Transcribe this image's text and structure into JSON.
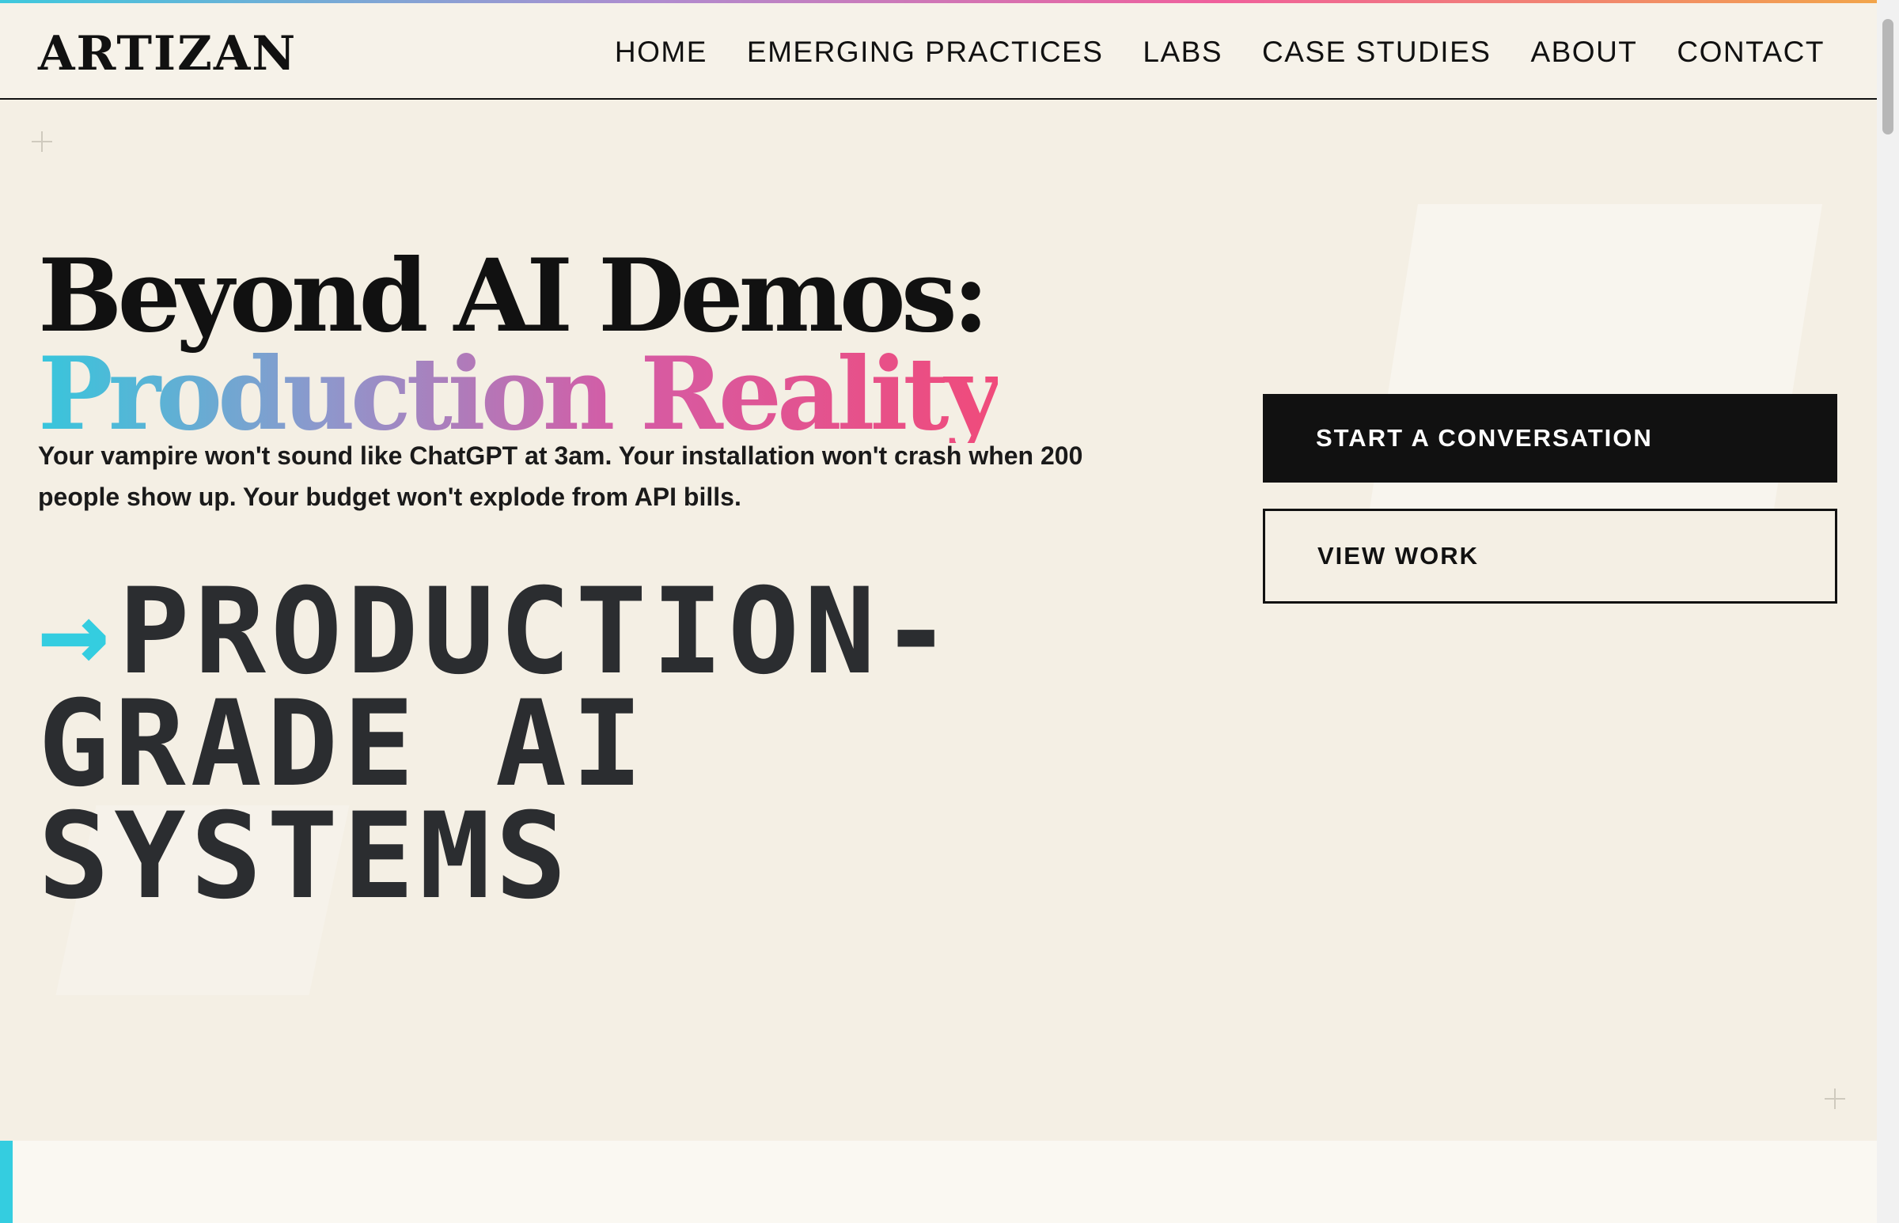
{
  "brand": {
    "logo": "ARTIZAN"
  },
  "nav": {
    "items": [
      {
        "label": "HOME"
      },
      {
        "label": "EMERGING PRACTICES"
      },
      {
        "label": "LABS"
      },
      {
        "label": "CASE STUDIES"
      },
      {
        "label": "ABOUT"
      },
      {
        "label": "CONTACT"
      }
    ]
  },
  "hero": {
    "title_line1": "Beyond AI Demos:",
    "title_line2": "Production Reality",
    "subtitle": "Your vampire won't sound like ChatGPT at 3am. Your installation won't crash when 200 people show up. Your budget won't explode from API bills.",
    "tagline_arrow": "→",
    "tagline_text": "PRODUCTION-GRADE AI SYSTEMS"
  },
  "cta": {
    "primary_label": "START A CONVERSATION",
    "secondary_label": "VIEW WORK"
  },
  "colors": {
    "background": "#f4efe4",
    "text": "#111111",
    "accent_cyan": "#34cde0",
    "accent_pink": "#f04b7b",
    "primary_button": "#111111"
  }
}
